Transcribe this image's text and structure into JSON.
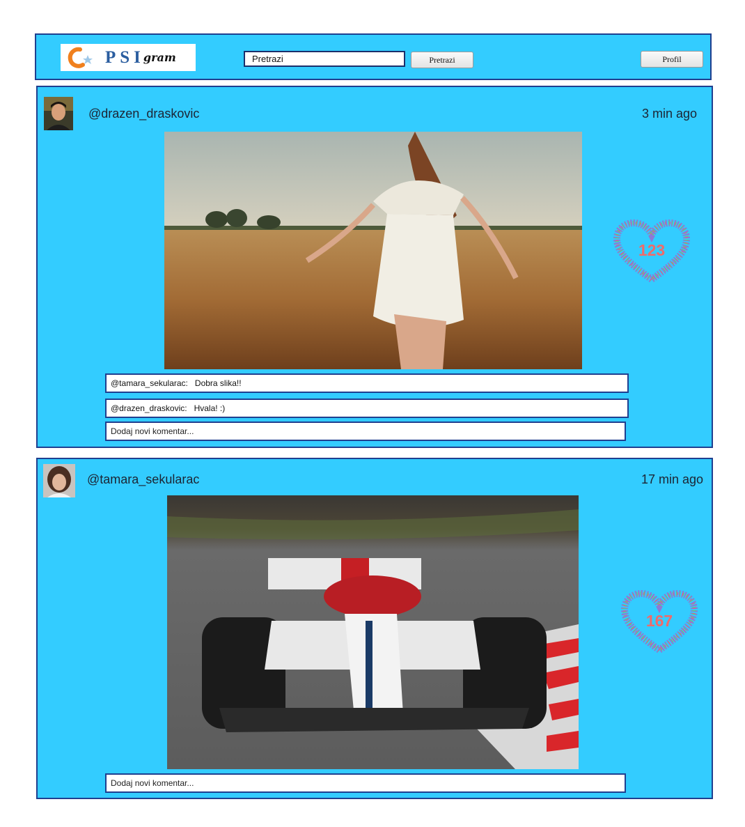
{
  "header": {
    "logo_text": "PSI",
    "logo_sub": "gram",
    "search_value": "Pretrazi",
    "search_button": "Pretrazi",
    "profile_button": "Profil"
  },
  "posts": [
    {
      "username": "@drazen_draskovic",
      "time": "3 min ago",
      "likes": "123",
      "comments": [
        {
          "author": "@tamara_sekularac:",
          "text": "Dobra slika!!"
        },
        {
          "author": "@drazen_draskovic:",
          "text": "Hvala! :)"
        }
      ],
      "new_comment_placeholder": "Dodaj novi komentar..."
    },
    {
      "username": "@tamara_sekularac",
      "time": "17 min ago",
      "likes": "167",
      "comments": [],
      "new_comment_placeholder": "Dodaj novi komentar..."
    }
  ],
  "colors": {
    "accent": "#33ccff",
    "border": "#1f3f8f",
    "likes": "#ef6b6b"
  }
}
